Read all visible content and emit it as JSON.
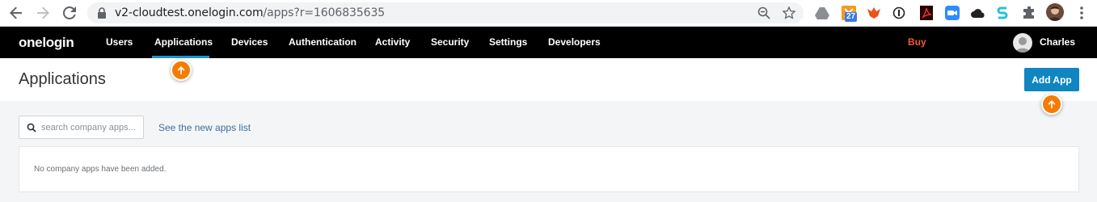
{
  "browser": {
    "url_host": "v2-cloudtest.onelogin.com",
    "url_path": "/apps?r=1606835635",
    "extension_badge": "27"
  },
  "topnav": {
    "logo": "onelogin",
    "items": [
      "Users",
      "Applications",
      "Devices",
      "Authentication",
      "Activity",
      "Security",
      "Settings",
      "Developers"
    ],
    "active_item": "Applications",
    "buy_label": "Buy",
    "user_name": "Charles"
  },
  "page": {
    "title": "Applications",
    "add_app_label": "Add App"
  },
  "content": {
    "search_placeholder": "search company apps...",
    "new_apps_link": "See the new apps list",
    "empty_message": "No company apps have been added."
  },
  "colors": {
    "nav_background": "#000000",
    "active_underline": "#1b95d0",
    "primary_button": "#0f86c1",
    "buy": "#ef5b32",
    "hint_marker": "#f57c00"
  }
}
